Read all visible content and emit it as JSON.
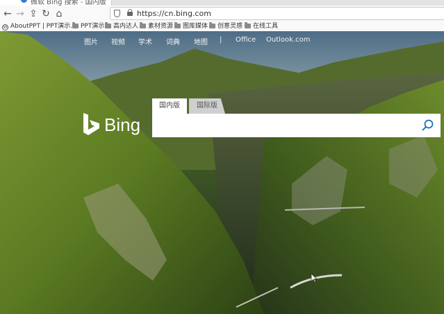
{
  "browser": {
    "tab": {
      "title": "微软 Bing 搜索 - 国内版"
    },
    "url": "https://cn.bing.com",
    "bookmarks": [
      {
        "label": "AboutPPT | PPT演示...",
        "icon": "wordpress-icon"
      },
      {
        "label": "PPT演示",
        "icon": "folder-icon"
      },
      {
        "label": "高内达人",
        "icon": "folder-icon"
      },
      {
        "label": "素材资源",
        "icon": "folder-icon"
      },
      {
        "label": "图库媒体",
        "icon": "folder-icon"
      },
      {
        "label": "创意灵感",
        "icon": "folder-icon"
      },
      {
        "label": "在线工具",
        "icon": "folder-icon"
      }
    ]
  },
  "bing": {
    "nav": [
      "图片",
      "视频",
      "学术",
      "词典",
      "地图",
      "|",
      "Office",
      "Outlook.com"
    ],
    "logo_text": "Bing",
    "tabs": [
      "国内版",
      "国际版"
    ],
    "search_placeholder": ""
  }
}
